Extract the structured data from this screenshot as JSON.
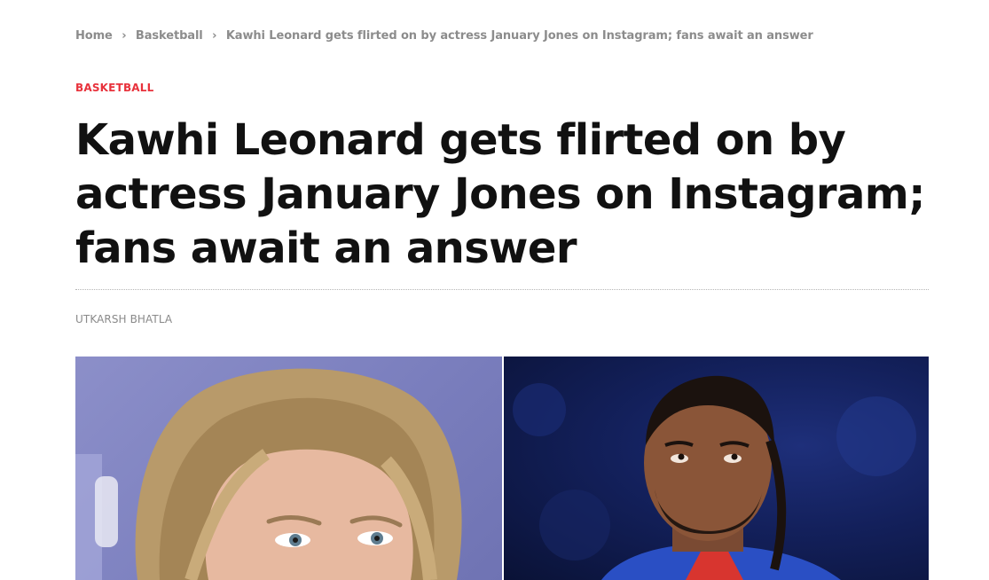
{
  "breadcrumb": {
    "items": [
      {
        "label": "Home"
      },
      {
        "label": "Basketball"
      },
      {
        "label": "Kawhi Leonard gets flirted on by actress January Jones on Instagram; fans await an answer"
      }
    ],
    "separator": "›"
  },
  "article": {
    "category": "BASKETBALL",
    "title": "Kawhi Leonard gets flirted on by actress January Jones on Instagram; fans await an answer",
    "author": "UTKARSH BHATLA"
  },
  "colors": {
    "category": "#e8323c",
    "meta_text": "#8c8c8c",
    "headline": "#111111"
  }
}
